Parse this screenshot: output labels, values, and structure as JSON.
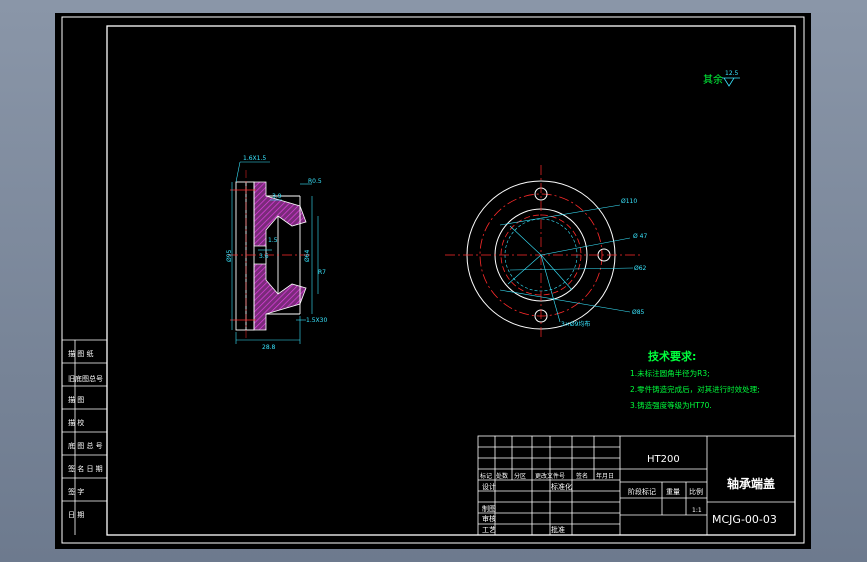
{
  "roughness": {
    "label": "其余",
    "value": "12.5"
  },
  "dimensions": {
    "chamfer": "1.6X1.5",
    "dim_3_9": "3.9",
    "radius_r0_5": "R0.5",
    "dia_95": "Ø95",
    "dia_64": "Ø64",
    "dim_r7": "R7",
    "dim_1_5": "1.5",
    "dim_3_6": "3.6",
    "dim_1_5x30": "1.5X30",
    "length_28_8": "28.8",
    "dia_110": "Ø110",
    "dia_47": "Ø 47",
    "dia_62": "Ø62",
    "dia_85": "Ø85",
    "holes_note": "3×Ø9均布"
  },
  "tech_requirements": {
    "title": "技术要求:",
    "items": [
      "1.未标注圆角半径为R3;",
      "2.零件铸造完成后，对其进行时效处理;",
      "3.铸造强度等级为HT70."
    ]
  },
  "left_column_labels": [
    "描 图 纸",
    "旧底图总号",
    "描 图",
    "描 校",
    "底 图 总 号",
    "签 名 日 期",
    "签 字",
    "日 期"
  ],
  "title_block": {
    "material": "HT200",
    "part_name": "轴承端盖",
    "drawing_number": "MCJG-00-03",
    "revision_header": [
      "标记",
      "处数",
      "分区",
      "更改文件号",
      "签名",
      "年月日"
    ],
    "signature_rows": [
      "设计",
      "制图",
      "审核",
      "工艺"
    ],
    "standardization": "标准化",
    "approval": "批准",
    "stage_label": "阶段标记",
    "weight_label": "重量",
    "scale_label": "比例",
    "scale": "1:1"
  },
  "colors": {
    "background": "#000000",
    "frame": "#ffffff",
    "dimension": "#39e6ff",
    "annotation": "#00ff3c",
    "center_line": "#ff2a2a",
    "hatch": "#c000c0"
  }
}
